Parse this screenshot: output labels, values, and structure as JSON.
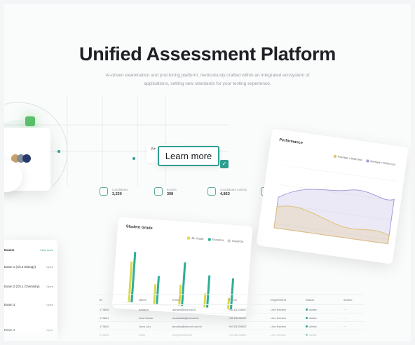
{
  "hero": {
    "title": "Unified Assessment Platform",
    "subtitle": "AI-driven examination and proctoring platform, meticulously crafted within an integrated ecosystem of applications, setting new standards for your testing experience."
  },
  "cta": {
    "learn_more": "Learn more",
    "ghost_label": "A+"
  },
  "stats": [
    {
      "label": "Candidates",
      "value": "3,230"
    },
    {
      "label": "Exams",
      "value": "398"
    },
    {
      "label": "Candidates Activity",
      "value": "4,863"
    }
  ],
  "performance_card": {
    "title": "Performance",
    "legend": [
      "Average • Male test",
      "Average • Other test"
    ],
    "colors": {
      "series1": "#e0c277",
      "series2": "#a79ad9"
    }
  },
  "bar_card": {
    "title": "Student Grade",
    "legend": [
      "4th Grade",
      "Excellent",
      "Good/Ok"
    ],
    "colors": {
      "yellow": "#d9d94b",
      "teal": "#2fae95",
      "gray": "#c8ccd0"
    }
  },
  "side_panel": {
    "header": "Exams",
    "link": "View more",
    "rows": [
      "Exam 1 (Ch.4 Biology)",
      "Exam 2 (Ch.1 Chemistry)",
      "Exam 3",
      "Exam 4"
    ],
    "row_actions": [
      "Open",
      "Open",
      "Open",
      "Open"
    ]
  },
  "table": {
    "headers": [
      "ID",
      "Name",
      "Email",
      "Phone",
      "Department",
      "Status",
      "Action"
    ],
    "rows": [
      [
        "173840",
        "Adriana",
        "adriana@school.id",
        "+62 81234567",
        "Line Section",
        "Active"
      ],
      [
        "173841",
        "Ana Clarita",
        "anaclarita@school.id",
        "+62 81232567",
        "Line Section",
        "Active"
      ],
      [
        "173842",
        "Jerry Lau",
        "jerrylau@school.com.id",
        "+62 81204567",
        "Line Section",
        "Active"
      ],
      [
        "173843",
        "Ruby",
        "ruby@school.id",
        "+62 81244567",
        "Line Section",
        "Active"
      ]
    ]
  }
}
